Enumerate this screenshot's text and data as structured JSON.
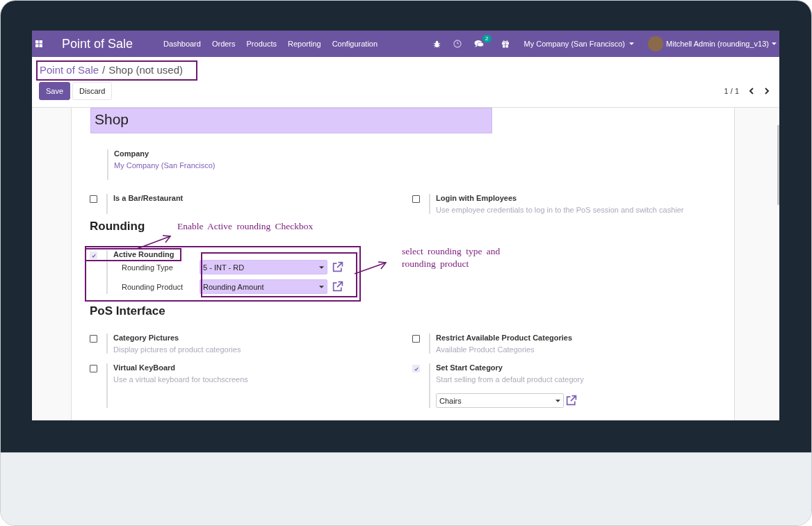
{
  "navbar": {
    "app_name": "Point of Sale",
    "menu": [
      "Dashboard",
      "Orders",
      "Products",
      "Reporting",
      "Configuration"
    ],
    "messages_badge": "2",
    "company": "My Company (San Francisco)",
    "user": "Mitchell Admin (rounding_v13)"
  },
  "breadcrumb": {
    "parent": "Point of Sale",
    "separator": "/",
    "current": "Shop (not used)"
  },
  "buttons": {
    "save": "Save",
    "discard": "Discard"
  },
  "pager": {
    "counter": "1 / 1"
  },
  "form": {
    "name": "Shop",
    "company": {
      "label": "Company",
      "value": "My Company (San Francisco)"
    },
    "top_settings": [
      {
        "label": "Is a Bar/Restaurant",
        "checked": false
      },
      {
        "label": "Login with Employees",
        "description": "Use employee credentials to log in to the PoS session and switch cashier",
        "checked": false
      }
    ],
    "rounding": {
      "title": "Rounding",
      "setting": {
        "label": "Active Rounding",
        "checked": true
      },
      "fields": [
        {
          "label": "Rounding Type",
          "value": "5 - INT - RD"
        },
        {
          "label": "Rounding Product",
          "value": "Rounding Amount"
        }
      ]
    },
    "pos_interface": {
      "title": "PoS Interface",
      "settings": [
        {
          "label": "Category Pictures",
          "description": "Display pictures of product categories",
          "checked": false
        },
        {
          "label": "Restrict Available Product Categories",
          "description": "Available Product Categories",
          "checked": false
        },
        {
          "label": "Virtual KeyBoard",
          "description": "Use a virtual keyboard for touchscreens",
          "checked": false
        },
        {
          "label": "Set Start Category",
          "description": "Start selling from a default product category",
          "checked": true,
          "select": "Chairs"
        }
      ]
    }
  },
  "annotations": [
    {
      "text": "Enable Active rounding Checkbox"
    },
    {
      "text": "select rounding type and rounding product"
    }
  ]
}
